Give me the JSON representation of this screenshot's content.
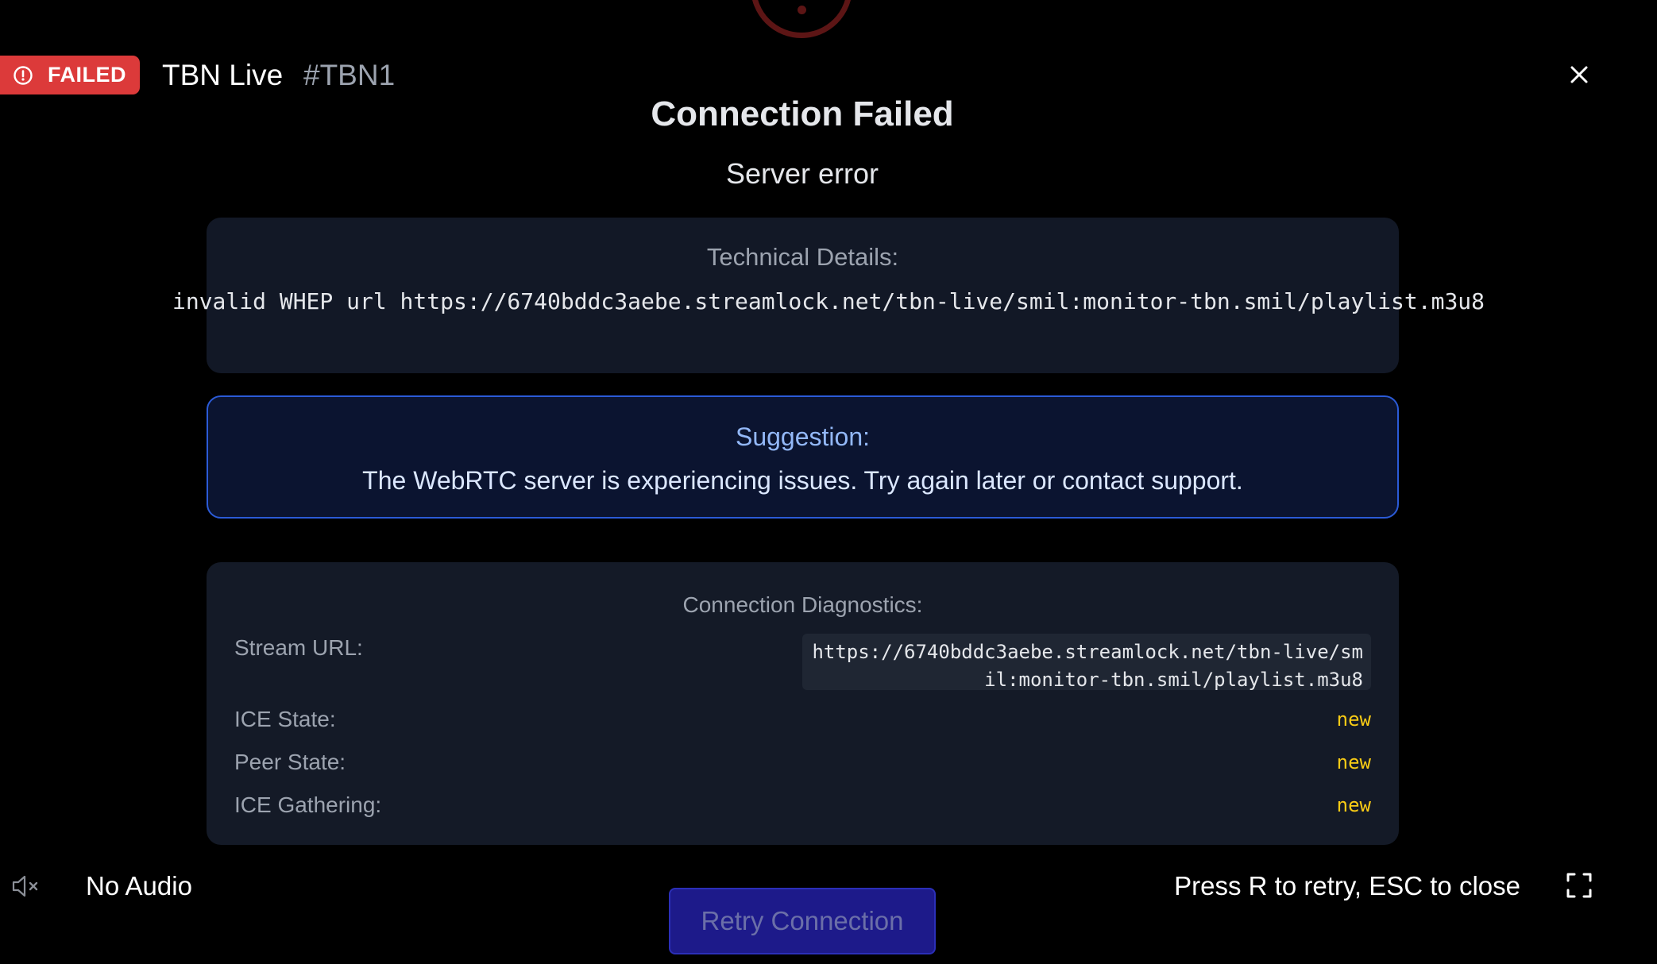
{
  "header": {
    "status_badge": "FAILED",
    "stream_name": "TBN Live",
    "stream_id": "#TBN1"
  },
  "error": {
    "title": "Connection Failed",
    "subtitle": "Server error",
    "technical_heading": "Technical Details:",
    "technical_message": "invalid WHEP url https://6740bddc3aebe.streamlock.net/tbn-live/smil:monitor-tbn.smil/playlist.m3u8"
  },
  "suggestion": {
    "heading": "Suggestion:",
    "text": "The WebRTC server is experiencing issues. Try again later or contact support."
  },
  "diagnostics": {
    "heading": "Connection Diagnostics:",
    "stream_url_label": "Stream URL:",
    "stream_url": "https://6740bddc3aebe.streamlock.net/tbn-live/smil:monitor-tbn.smil/playlist.m3u8",
    "ice_state_label": "ICE State:",
    "ice_state": "new",
    "peer_state_label": "Peer State:",
    "peer_state": "new",
    "ice_gathering_label": "ICE Gathering:",
    "ice_gathering": "new"
  },
  "footer": {
    "audio_label": "No Audio",
    "retry_button": "Retry Connection",
    "hint": "Press R to retry, ESC to close"
  },
  "icons": {
    "status": "alert-circle-icon",
    "close": "close-icon",
    "mute": "speaker-muted-icon",
    "fullscreen": "fullscreen-icon",
    "spinner": "error-ring-icon"
  },
  "colors": {
    "badge": "#dc3a3a",
    "suggestion_border": "#2b5bd7",
    "diagnostic_value": "#facc15",
    "retry_button": "#1d1a8a"
  }
}
